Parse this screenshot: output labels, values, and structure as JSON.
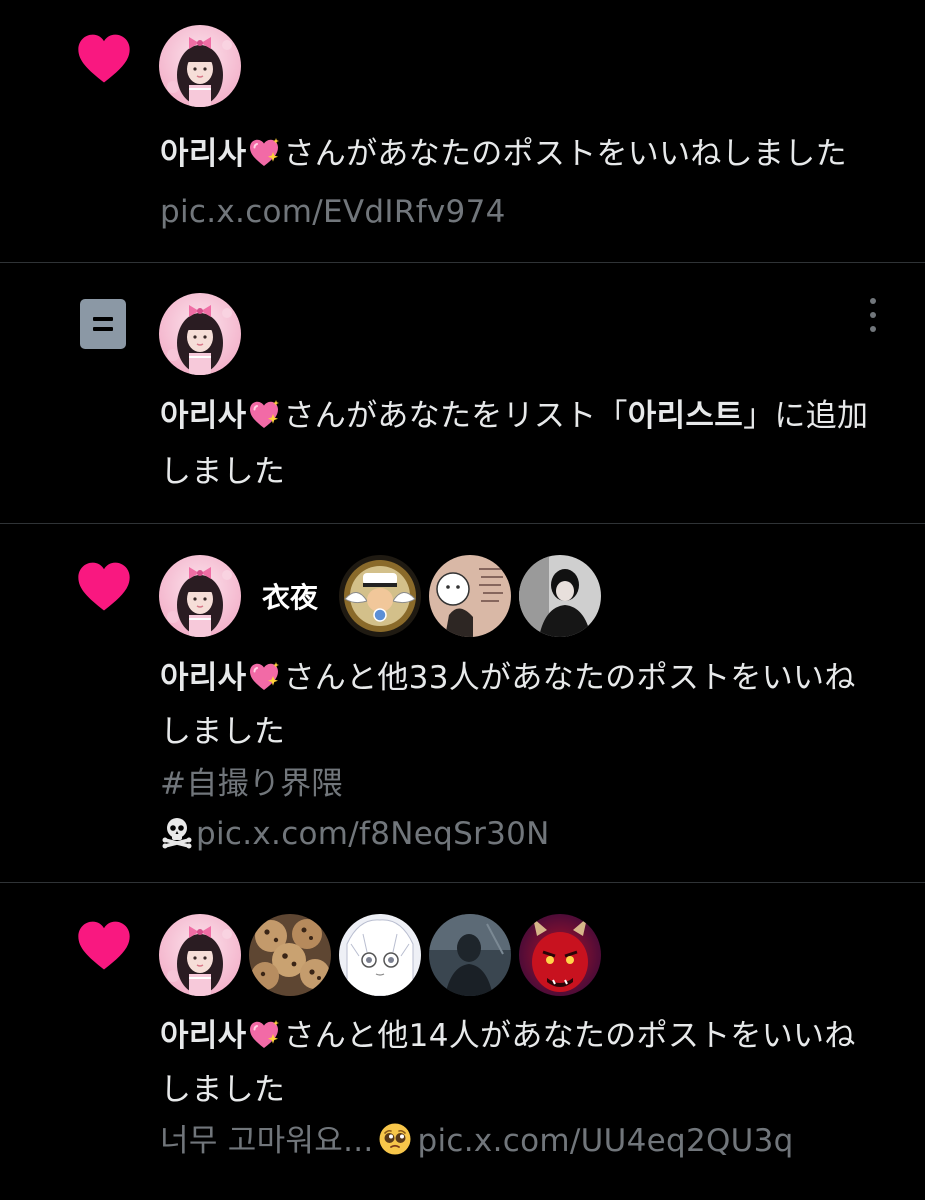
{
  "notifications": [
    {
      "type": "like",
      "actor": "아리사",
      "actor_emoji": "sparkling-heart-icon",
      "message": "さんがあなたのポストをいいねしました",
      "preview": [
        "pic.x.com/EVdIRfv974"
      ]
    },
    {
      "type": "list-add",
      "actor": "아리사",
      "actor_emoji": "sparkling-heart-icon",
      "message_before": "さんがあなたをリスト「",
      "list_name": "아리스트",
      "message_after": "」に追加",
      "message_line2": "しました"
    },
    {
      "type": "like",
      "actor": "아리사",
      "actor_emoji": "sparkling-heart-icon",
      "message": "さんと他33人があなたのポストをいいね",
      "message_line2": "しました",
      "preview": [
        "#自撮り界隈",
        "pic.x.com/f8NeqSr30N"
      ],
      "preview_icon": "skull-crossbones-icon"
    },
    {
      "type": "like",
      "actor": "아리사",
      "actor_emoji": "sparkling-heart-icon",
      "message": "さんと他14人があなたのポストをいいね",
      "message_line2": "しました",
      "preview_text": "너무 고마워요...",
      "preview_emoji": "pleading-face-icon",
      "preview_link": "pic.x.com/UU4eq2QU3q"
    }
  ],
  "avatar_logo_text": "衣夜",
  "colors": {
    "background": "#000000",
    "like_heart": "#f91880",
    "primary_text": "#e7e9ea",
    "secondary_text": "#71767b",
    "divider": "#2f3336"
  }
}
